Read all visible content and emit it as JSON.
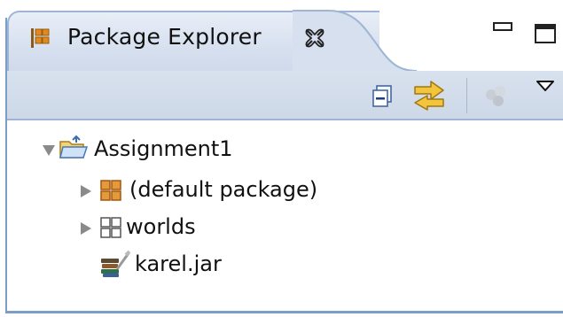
{
  "view": {
    "tab_title": "Package Explorer",
    "tab_icon": "package-explorer-icon",
    "close_icon": "close-icon",
    "minimize_icon": "minimize-icon",
    "maximize_icon": "maximize-icon"
  },
  "toolbar": {
    "collapse_icon": "collapse-all-icon",
    "link_icon": "link-with-editor-icon",
    "filter_icon": "filter-icon",
    "menu_icon": "view-menu-icon"
  },
  "tree": {
    "project": {
      "label": "Assignment1",
      "icon": "project-folder-icon",
      "expanded": true
    },
    "children": [
      {
        "label": "(default package)",
        "icon": "package-icon",
        "expandable": true
      },
      {
        "label": "worlds",
        "icon": "package-folder-icon",
        "expandable": true
      },
      {
        "label": "karel.jar",
        "icon": "jar-icon",
        "expandable": false
      }
    ]
  },
  "colors": {
    "border": "#7b9ec9",
    "tab_bg": "#d6e0ef",
    "toolbar_bg": "#cdd8e8"
  }
}
